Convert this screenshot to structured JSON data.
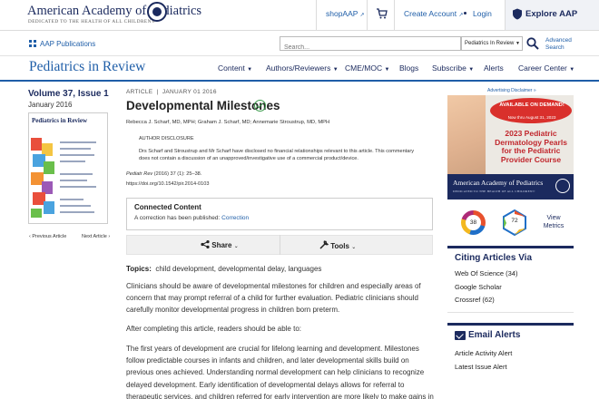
{
  "header": {
    "org_name": "American Academy of Pediatrics",
    "org_tagline": "DEDICATED TO THE HEALTH OF ALL CHILDREN®",
    "shop_label": "shopAAP",
    "create_account_label": "Create Account",
    "login_label": "Login",
    "explore_label": "Explore AAP"
  },
  "subheader": {
    "publications_label": "AAP Publications",
    "search_placeholder": "Search...",
    "search_scope": "Pediatrics In Review",
    "advanced_search_line1": "Advanced",
    "advanced_search_line2": "Search"
  },
  "journal_bar": {
    "journal_name": "Pediatrics in Review",
    "nav": [
      {
        "label": "Content"
      },
      {
        "label": "Authors/Reviewers"
      },
      {
        "label": "CME/MOC"
      },
      {
        "label": "Blogs"
      },
      {
        "label": "Subscribe"
      },
      {
        "label": "Alerts"
      },
      {
        "label": "Career Center"
      }
    ]
  },
  "issue": {
    "volume_issue": "Volume 37, Issue 1",
    "date": "January 2016",
    "cover_title": "Pediatrics in Review",
    "prev_label": "Previous Article",
    "next_label": "Next Article"
  },
  "article": {
    "type": "ARTICLE",
    "date": "JANUARY 01 2016",
    "title": "Developmental Milestones",
    "authors": "Rebecca J. Scharf, MD, MPH; Graham J. Scharf, MD; Annemarie Stroustrup, MD, MPH",
    "disclosure_heading": "AUTHOR DISCLOSURE",
    "disclosure_text": "Drs Scharf and Stroustrup and Mr Scharf have disclosed no financial relationships relevant to this article. This commentary does not contain a discussion of an unapproved/investigative use of a commercial product/device.",
    "citation_journal": "Pediatr Rev",
    "citation_details": "(2016) 37 (1): 25–38.",
    "doi": "https://doi.org/10.1542/pir.2014-0103",
    "connected_content_title": "Connected Content",
    "connected_content_text": "A correction has been published:",
    "connected_content_link": "Correction",
    "share_label": "Share",
    "tools_label": "Tools",
    "topics_label": "Topics:",
    "topics": "child development, developmental delay, languages",
    "paragraphs": [
      "Clinicians should be aware of developmental milestones for children and especially areas of concern that may prompt referral of a child for further evaluation. Pediatric clinicians should carefully monitor developmental progress in children born preterm.",
      "After completing this article, readers should be able to:",
      "The first years of development are crucial for lifelong learning and development. Milestones follow predictable courses in infants and children, and later developmental skills build on previous ones achieved. Understanding normal development can help clinicians to recognize delayed development. Early identification of developmental delays allows for referral to therapeutic services, and children referred for early intervention are more likely to make gains in"
    ]
  },
  "sidebar": {
    "ad_disclaimer": "Advertising Disclaimer »",
    "ad": {
      "badge_line1": "AVAILABLE ON DEMAND!",
      "badge_line2": "Now thru August 31, 2023",
      "title": "2023 Pediatric Dermatology Pearls for the Pediatric Provider Course",
      "footer_name": "American Academy of Pediatrics",
      "footer_tagline": "DEDICATED TO THE HEALTH OF ALL CHILDREN®"
    },
    "altmetric_score": "38",
    "dimensions_count": "72",
    "view_metrics_line1": "View",
    "view_metrics_line2": "Metrics",
    "citing_heading": "Citing Articles Via",
    "citing": [
      {
        "label": "Web Of Science (34)"
      },
      {
        "label": "Google Scholar"
      },
      {
        "label": "Crossref (62)"
      }
    ],
    "email_heading": "Email Alerts",
    "email_alerts": [
      {
        "label": "Article Activity Alert"
      },
      {
        "label": "Latest Issue Alert"
      }
    ]
  },
  "colors": {
    "navy": "#1b2a5e",
    "link_blue": "#1f5ea8",
    "ad_red": "#c1272d",
    "verified_green": "#3a9a4a"
  }
}
